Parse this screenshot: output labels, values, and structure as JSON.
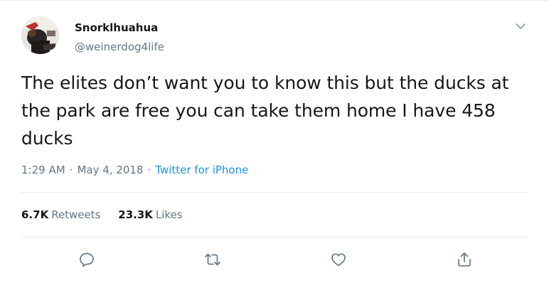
{
  "tweet": {
    "display_name": "Snorklhuahua",
    "handle": "@weinerdog4life",
    "text": "The elites don’t want you to know this but the ducks at the park are free you can take them home I have 458 ducks",
    "time": "1:29 AM",
    "separator": "·",
    "date": "May 4, 2018",
    "source": "Twitter for iPhone"
  },
  "stats": {
    "retweets_count": "6.7K",
    "retweets_label": "Retweets",
    "likes_count": "23.3K",
    "likes_label": "Likes"
  },
  "icons": {
    "menu": "chevron-down-icon",
    "reply": "reply-icon",
    "retweet": "retweet-icon",
    "like": "heart-icon",
    "share": "share-icon"
  },
  "colors": {
    "text": "#14171a",
    "secondary": "#657786",
    "link": "#1b95e0",
    "border": "#e6ecf0"
  }
}
